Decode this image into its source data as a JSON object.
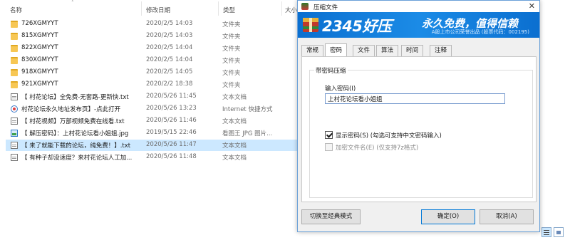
{
  "explorer": {
    "headers": {
      "name": "名称",
      "date": "修改日期",
      "type": "类型",
      "size": "大小"
    },
    "files": [
      {
        "icon": "folder-icon",
        "name": "726XGMYYT",
        "date": "2020/2/5 14:03",
        "type": "文件夹"
      },
      {
        "icon": "folder-icon",
        "name": "815XGMYYT",
        "date": "2020/2/5 14:03",
        "type": "文件夹"
      },
      {
        "icon": "folder-icon",
        "name": "822XGMYYT",
        "date": "2020/2/5 14:04",
        "type": "文件夹"
      },
      {
        "icon": "folder-icon",
        "name": "830XGMYYT",
        "date": "2020/2/5 14:04",
        "type": "文件夹"
      },
      {
        "icon": "folder-icon",
        "name": "918XGMYYT",
        "date": "2020/2/5 14:05",
        "type": "文件夹"
      },
      {
        "icon": "folder-icon",
        "name": "921XGMYYT",
        "date": "2020/2/2 18:38",
        "type": "文件夹"
      },
      {
        "icon": "text-file-icon",
        "name": "【 村花论坛】全免费-无套路-更新快.txt",
        "date": "2020/5/26 11:45",
        "type": "文本文档"
      },
      {
        "icon": "internet-shortcut-icon",
        "name": "村花论坛永久地址发布页】-点此打开",
        "date": "2020/5/26 13:23",
        "type": "Internet 快捷方式"
      },
      {
        "icon": "text-file-icon",
        "name": "【 村花视频】万部视频免费在线看.txt",
        "date": "2020/5/26 11:46",
        "type": "文本文档"
      },
      {
        "icon": "image-file-icon",
        "name": "【 解压密码】：上村花论坛看小姐姐.jpg",
        "date": "2019/5/15 22:46",
        "type": "看图王 JPG 图片..."
      },
      {
        "icon": "text-file-icon",
        "name": "【 来了就能下载的论坛，纯免费！】.txt",
        "date": "2020/5/26 11:47",
        "type": "文本文档",
        "selected": true
      },
      {
        "icon": "text-file-icon",
        "name": "【 有种子却没速度？来村花论坛人工加...",
        "date": "2020/5/26 11:48",
        "type": "文本文档"
      }
    ]
  },
  "dialog": {
    "title": "压缩文件",
    "close_glyph": "✕",
    "banner": {
      "brand": "2345好压",
      "slogan": "永久免费，值得信赖",
      "sub": "A股上市公司荣誉出品 (股票代码：002195)"
    },
    "tabs": [
      "常规",
      "密码",
      "文件",
      "算法",
      "时间",
      "注释"
    ],
    "active_tab": "密码",
    "group_title": "带密码压缩",
    "password_label": "输入密码(I)",
    "password_value": "上村花论坛看小姐姐",
    "show_password": {
      "label": "显示密码(S)   (勾选可支持中文密码输入)",
      "checked": true
    },
    "encrypt_names": {
      "label": "加密文件名(E)   (仅支持7z格式)",
      "checked": false,
      "disabled": true
    },
    "buttons": {
      "classic": "切换至经典模式",
      "ok": "确定(O)",
      "cancel": "取消(A)"
    }
  }
}
